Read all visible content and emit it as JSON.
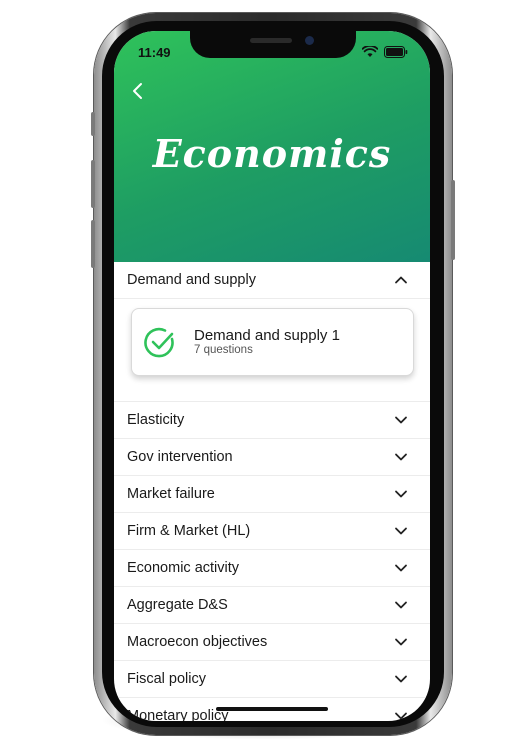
{
  "status_bar": {
    "time": "11:49"
  },
  "header": {
    "title": "Economics"
  },
  "sections": [
    {
      "label": "Demand and supply",
      "expanded": true
    },
    {
      "label": "Elasticity",
      "expanded": false
    },
    {
      "label": "Gov intervention",
      "expanded": false
    },
    {
      "label": "Market failure",
      "expanded": false
    },
    {
      "label": "Firm & Market (HL)",
      "expanded": false
    },
    {
      "label": "Economic activity",
      "expanded": false
    },
    {
      "label": "Aggregate D&S",
      "expanded": false
    },
    {
      "label": "Macroecon objectives",
      "expanded": false
    },
    {
      "label": "Fiscal policy",
      "expanded": false
    },
    {
      "label": "Monetary policy",
      "expanded": false
    }
  ],
  "expanded_card": {
    "title": "Demand and supply 1",
    "subtitle": "7 questions",
    "icon": "check-circle-icon"
  },
  "colors": {
    "accent": "#2fc25a",
    "header_gradient_end": "#168a72"
  }
}
